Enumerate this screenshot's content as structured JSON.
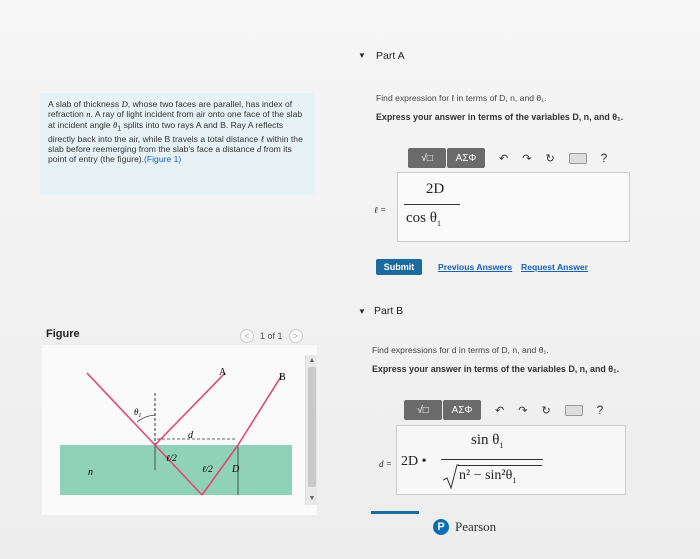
{
  "problem": {
    "text_1": "A slab of thickness ",
    "var_D": "D",
    "text_2": ", whose two faces are parallel, has index of refraction ",
    "var_n": "n",
    "text_3": ". A ray of light incident from air onto one face of the slab at incident angle ",
    "var_theta": "θ",
    "sub_1": "1",
    "text_4": " splits into two rays A and B. Ray A reflects directly back into the air, while B travels a total distance ",
    "var_l": "ℓ",
    "text_5": " within the slab before reemerging from the slab's face a distance ",
    "var_d": "d",
    "text_6": " from its point of entry (the figure).",
    "link": "(Figure 1)"
  },
  "figure": {
    "title": "Figure",
    "pager": "1 of 1",
    "prev": "<",
    "next": ">",
    "labels": {
      "A": "A",
      "B": "B",
      "theta": "θ",
      "theta_sub": "1",
      "d": "d",
      "l_half_1": "ℓ/2",
      "l_half_2": "ℓ/2",
      "D": "D",
      "n": "n"
    }
  },
  "partA": {
    "title": "Part A",
    "prompt": "Find expression for ℓ in terms of D, n, and θ₁.",
    "instruction": "Express your answer in terms of the variables D, n, and θ₁.",
    "toolbar": {
      "templates": "√□",
      "symbols": "ΑΣΦ",
      "undo": "↶",
      "redo": "↷",
      "reset": "↻",
      "help": "?"
    },
    "lhs": "ℓ =",
    "numerator": "2D",
    "denominator": "cos θ",
    "denominator_sub": "1",
    "submit": "Submit",
    "previous_answers": "Previous Answers",
    "request_answer": "Request Answer"
  },
  "partB": {
    "title": "Part B",
    "prompt": "Find expressions for d in terms of D, n, and θ₁.",
    "instruction": "Express your answer in terms of the variables D, n, and θ₁.",
    "toolbar": {
      "templates": "√□",
      "symbols": "ΑΣΦ",
      "undo": "↶",
      "redo": "↷",
      "reset": "↻",
      "help": "?"
    },
    "lhs": "d =",
    "coef": "2D •",
    "numerator": "sin θ",
    "numerator_sub": "1",
    "denominator": "n² − sin²θ",
    "denominator_sub": "1"
  },
  "footer": {
    "brand": "Pearson",
    "logo": "P"
  }
}
